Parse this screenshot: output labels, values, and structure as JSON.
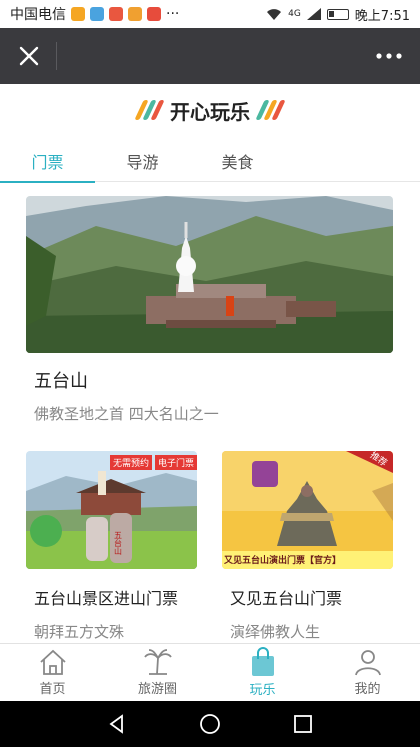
{
  "status_bar": {
    "carrier": "中国电信",
    "more": "···",
    "network": "4G",
    "time_text": "晚上7:51",
    "app_chip_colors": [
      "#f5a623",
      "#4aa3df",
      "#e9573f",
      "#f0a030",
      "#e74c3c"
    ]
  },
  "title_bar": {
    "close_icon": "close-icon",
    "more_icon": "more-dots-icon",
    "background": "#3a3a3e"
  },
  "header": {
    "title": "开心玩乐",
    "deco_colors": [
      "#f5a623",
      "#4bb8a0",
      "#e9573f"
    ]
  },
  "tabs": [
    {
      "label": "门票",
      "active": true
    },
    {
      "label": "导游",
      "active": false
    },
    {
      "label": "美食",
      "active": false
    }
  ],
  "featured": {
    "name": "五台山",
    "subtitle": "佛教圣地之首  四大名山之一",
    "image": "temple-mountain-photo"
  },
  "products": [
    {
      "name": "五台山景区进山门票",
      "subtitle": "朝拜五方文殊",
      "badges": [
        "无需预约",
        "电子门票"
      ],
      "image": "temple-gate-photo",
      "stone_text": "五台山"
    },
    {
      "name": "又见五台山门票",
      "subtitle": "演绎佛教人生",
      "corner_badge": "推荐",
      "banner": "又见五台山演出门票【官方】",
      "image": "stupa-poster"
    }
  ],
  "bottom_nav": [
    {
      "label": "首页",
      "icon": "home-icon",
      "active": false
    },
    {
      "label": "旅游圈",
      "icon": "palm-tree-icon",
      "active": false
    },
    {
      "label": "玩乐",
      "icon": "shopping-bag-icon",
      "active": true
    },
    {
      "label": "我的",
      "icon": "user-icon",
      "active": false
    }
  ],
  "accent_color": "#2bb0c2"
}
